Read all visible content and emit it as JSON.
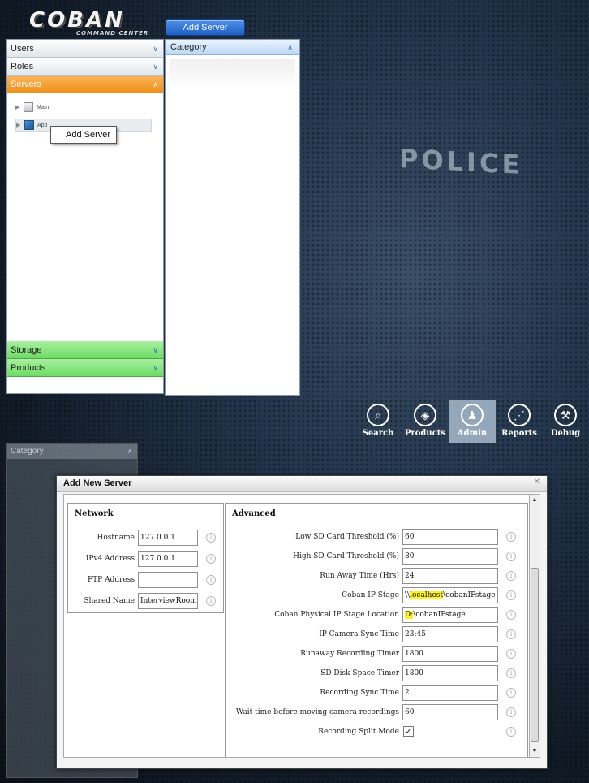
{
  "app": {
    "logo_main": "COBAN",
    "logo_sub": "COMMAND CENTER",
    "add_server_button": "Add Server"
  },
  "sidebar": {
    "sections": [
      {
        "label": "Users",
        "chevron": "∨"
      },
      {
        "label": "Roles",
        "chevron": "∨"
      },
      {
        "label": "Servers",
        "chevron": "∧"
      },
      {
        "label": "Storage",
        "chevron": "∨"
      },
      {
        "label": "Products",
        "chevron": "∨"
      }
    ],
    "tree": [
      {
        "label": "Main"
      },
      {
        "label": "App"
      }
    ],
    "context_menu": "Add Server"
  },
  "category": {
    "title": "Category",
    "chevron": "∧"
  },
  "background_text": "POLICE",
  "nav": {
    "items": [
      {
        "label": "Search",
        "icon": "search-icon",
        "glyph": "⌕"
      },
      {
        "label": "Products",
        "icon": "target-icon",
        "glyph": "◈"
      },
      {
        "label": "Admin",
        "icon": "user-icon",
        "glyph": "♟"
      },
      {
        "label": "Reports",
        "icon": "chart-icon",
        "glyph": "⋰"
      },
      {
        "label": "Debug",
        "icon": "wrench-icon",
        "glyph": "⚒"
      }
    ],
    "active": "Admin"
  },
  "dialog": {
    "title": "Add New Server",
    "close_glyph": "✕",
    "network": {
      "title": "Network",
      "fields": [
        {
          "label": "Hostname",
          "value": "127.0.0.1"
        },
        {
          "label": "IPv4 Address",
          "value": "127.0.0.1"
        },
        {
          "label": "FTP Address",
          "value": ""
        },
        {
          "label": "Shared Name",
          "value": "InterviewRoom"
        }
      ]
    },
    "advanced": {
      "title": "Advanced",
      "fields": [
        {
          "label": "Low SD Card Threshold (%)",
          "value": "60"
        },
        {
          "label": "High SD Card Threshold (%)",
          "value": "80"
        },
        {
          "label": "Run Away Time (Hrs)",
          "value": "24"
        },
        {
          "label": "Coban IP Stage",
          "value_pre": "\\\\",
          "value_hl": "localhost",
          "value_post": "\\cobanIPstage"
        },
        {
          "label": "Coban Physical IP Stage Location",
          "value_hl": "D:",
          "value_post": "\\cobanIPstage"
        },
        {
          "label": "IP Camera Sync Time",
          "value": "23:45"
        },
        {
          "label": "Runaway Recording Timer",
          "value": "1800"
        },
        {
          "label": "SD Disk Space Timer",
          "value": "1800"
        },
        {
          "label": "Recording Sync Time",
          "value": "2"
        },
        {
          "label": "Wait time before moving camera recordings",
          "value": "60"
        },
        {
          "label": "Recording Split Mode",
          "checked": true,
          "check_glyph": "✓"
        }
      ]
    },
    "info_glyph": "i"
  },
  "colors": {
    "servers_header": "#f08f1a",
    "green_headers": "#6ddc65",
    "highlight": "#fdf22a",
    "add_server_button": "#1f5fc4"
  }
}
